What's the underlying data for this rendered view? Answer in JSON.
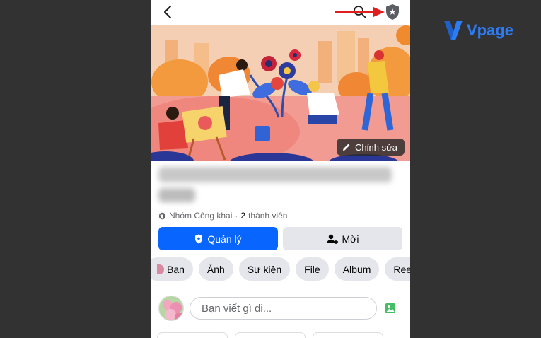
{
  "watermark": {
    "brand": "Vpage"
  },
  "colors": {
    "accent": "#0866ff",
    "secondary_button": "#e4e6eb",
    "annotation_arrow": "#e01e1e",
    "background": "#323232"
  },
  "topbar": {
    "back_icon": "chevron-left-icon",
    "search_icon": "search-icon",
    "admin_icon": "shield-star-icon"
  },
  "cover": {
    "edit_label": "Chỉnh sửa"
  },
  "group": {
    "privacy": "Nhóm Công khai",
    "separator": "·",
    "member_count": "2",
    "member_suffix": "thành viên"
  },
  "actions": {
    "manage_label": "Quản lý",
    "invite_label": "Mời"
  },
  "tabs": [
    {
      "label": "Bạn"
    },
    {
      "label": "Ảnh"
    },
    {
      "label": "Sự kiện"
    },
    {
      "label": "File"
    },
    {
      "label": "Album"
    },
    {
      "label": "Reels"
    }
  ],
  "composer": {
    "placeholder": "Bạn viết gì đi..."
  }
}
